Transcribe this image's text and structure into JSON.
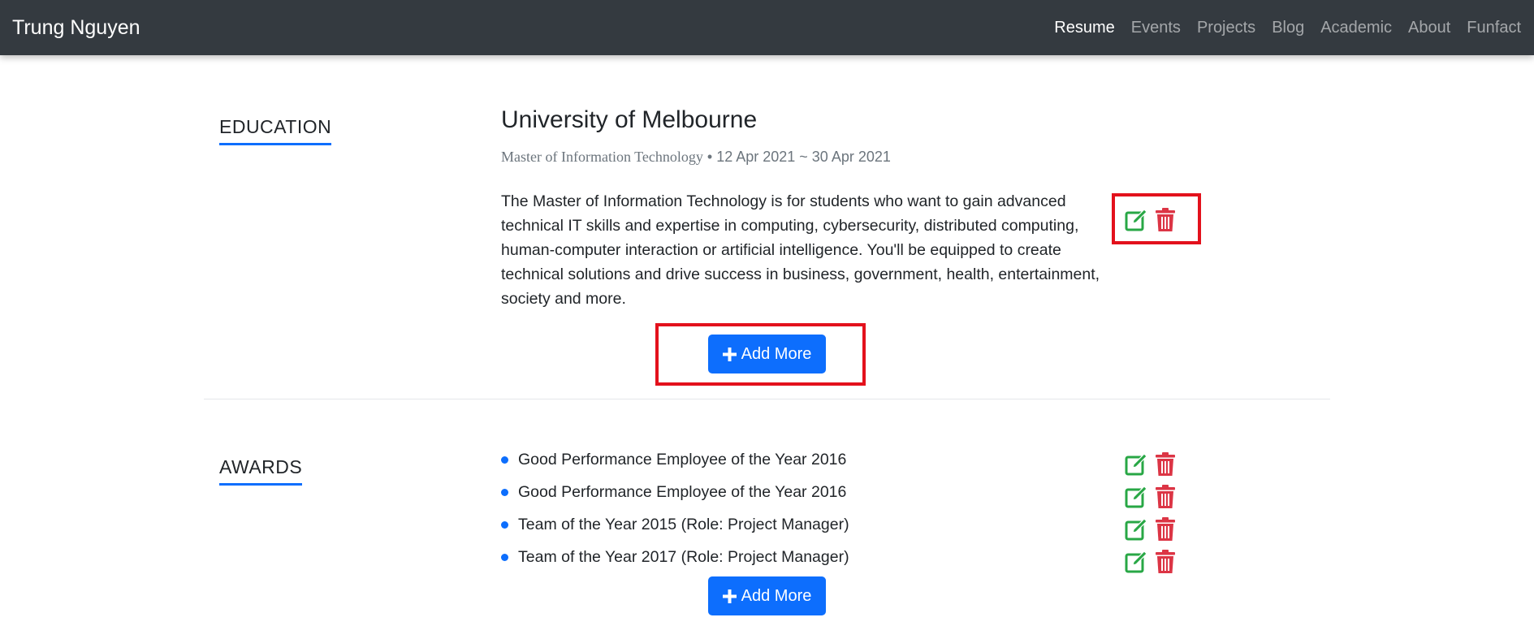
{
  "navbar": {
    "brand": "Trung Nguyen",
    "links": [
      {
        "label": "Resume",
        "active": true
      },
      {
        "label": "Events"
      },
      {
        "label": "Projects"
      },
      {
        "label": "Blog"
      },
      {
        "label": "Academic"
      },
      {
        "label": "About"
      },
      {
        "label": "Funfact"
      }
    ]
  },
  "education": {
    "section_title": "EDUCATION",
    "school": "University of Melbourne",
    "degree": "Master of Information Technology",
    "separator": "•",
    "dates": "12 Apr 2021 ~ 30 Apr 2021",
    "description": "The Master of Information Technology is for students who want to gain advanced technical IT skills and expertise in computing, cybersecurity, distributed computing, human-computer interaction or artificial intelligence. You'll be equipped to create technical solutions and drive success in business, government, health, entertainment, society and more.",
    "add_label": "Add More"
  },
  "awards": {
    "section_title": "AWARDS",
    "items": [
      "Good Performance Employee of the Year 2016",
      "Good Performance Employee of the Year 2016",
      "Team of the Year 2015 (Role: Project Manager)",
      "Team of the Year 2017 (Role: Project Manager)"
    ],
    "add_label": "Add More"
  },
  "icons": {
    "edit": "edit-icon",
    "delete": "trash-icon",
    "add": "plus-icon"
  },
  "colors": {
    "navbar_bg": "#343a40",
    "primary": "#0d6efd",
    "edit": "#28a745",
    "delete": "#dc3545",
    "highlight": "#e3111c"
  }
}
